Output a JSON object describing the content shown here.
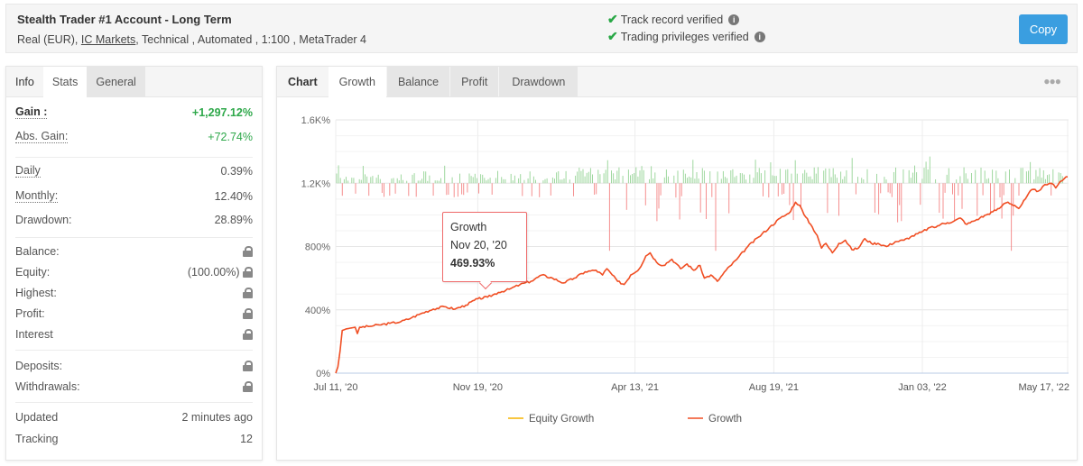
{
  "header": {
    "title": "Stealth Trader #1 Account - Long Term",
    "subtitle_prefix": "Real (EUR),",
    "broker_link": "IC Markets",
    "subtitle_suffix": ", Technical , Automated , 1:100 , MetaTrader 4",
    "verifications": [
      {
        "label": "Track record verified",
        "icon": "check-icon"
      },
      {
        "label": "Trading privileges verified",
        "icon": "check-icon"
      }
    ],
    "copy_label": "Copy"
  },
  "left_panel": {
    "tabs": [
      "Info",
      "Stats",
      "General"
    ],
    "active_tab": "Stats",
    "gain": {
      "label": "Gain :",
      "value": "+1,297.12%"
    },
    "abs_gain": {
      "label": "Abs. Gain:",
      "value": "+72.74%"
    },
    "daily": {
      "label": "Daily",
      "value": "0.39%"
    },
    "monthly": {
      "label": "Monthly:",
      "value": "12.40%"
    },
    "drawdown": {
      "label": "Drawdown:",
      "value": "28.89%"
    },
    "balance": {
      "label": "Balance:"
    },
    "equity": {
      "label": "Equity:",
      "value": "(100.00%)"
    },
    "highest": {
      "label": "Highest:"
    },
    "profit": {
      "label": "Profit:"
    },
    "interest": {
      "label": "Interest"
    },
    "deposits": {
      "label": "Deposits:"
    },
    "withdrawals": {
      "label": "Withdrawals:"
    },
    "updated": {
      "label": "Updated",
      "value": "2 minutes ago"
    },
    "tracking": {
      "label": "Tracking",
      "value": "12"
    }
  },
  "chart_panel": {
    "tabs": [
      "Chart",
      "Growth",
      "Balance",
      "Profit",
      "Drawdown"
    ],
    "active_tab": "Growth",
    "menu_icon": "more-dots-icon"
  },
  "tooltip": {
    "series": "Growth",
    "date": "Nov 20, '20",
    "value": "469.93%"
  },
  "colors": {
    "growth": "#f04e23",
    "equity": "#f5b400",
    "profit_bar": "#8fd18f",
    "loss_bar": "#f47c7c",
    "accent": "#3a9ee0",
    "positive": "#2ea84a"
  },
  "chart_data": {
    "type": "line",
    "title": "",
    "xlabel": "",
    "ylabel": "",
    "ylim": [
      0,
      1600
    ],
    "y_ticks": [
      "0%",
      "400%",
      "800%",
      "1.2K%",
      "1.6K%"
    ],
    "y_tick_values": [
      0,
      400,
      800,
      1200,
      1600
    ],
    "x_ticks": [
      "Jul 11, '20",
      "Nov 19, '20",
      "Apr 13, '21",
      "Aug 19, '21",
      "Jan 03, '22",
      "May 17, '22"
    ],
    "x_range_days": [
      0,
      675
    ],
    "x_tick_days": [
      0,
      131,
      276,
      404,
      541,
      675
    ],
    "grid": true,
    "legend": {
      "position": "bottom",
      "entries": [
        "Equity Growth",
        "Growth"
      ]
    },
    "series": [
      {
        "name": "Growth",
        "points": [
          [
            0,
            0
          ],
          [
            2,
            40
          ],
          [
            4,
            140
          ],
          [
            6,
            270
          ],
          [
            10,
            280
          ],
          [
            14,
            285
          ],
          [
            18,
            290
          ],
          [
            20,
            250
          ],
          [
            22,
            290
          ],
          [
            30,
            295
          ],
          [
            40,
            305
          ],
          [
            50,
            315
          ],
          [
            60,
            325
          ],
          [
            70,
            350
          ],
          [
            80,
            380
          ],
          [
            90,
            405
          ],
          [
            100,
            420
          ],
          [
            110,
            405
          ],
          [
            120,
            430
          ],
          [
            131,
            470
          ],
          [
            140,
            480
          ],
          [
            150,
            510
          ],
          [
            160,
            530
          ],
          [
            170,
            560
          ],
          [
            180,
            580
          ],
          [
            190,
            620
          ],
          [
            200,
            600
          ],
          [
            210,
            570
          ],
          [
            220,
            600
          ],
          [
            230,
            640
          ],
          [
            240,
            650
          ],
          [
            246,
            620
          ],
          [
            250,
            660
          ],
          [
            260,
            580
          ],
          [
            266,
            560
          ],
          [
            272,
            620
          ],
          [
            280,
            660
          ],
          [
            286,
            740
          ],
          [
            290,
            760
          ],
          [
            296,
            700
          ],
          [
            302,
            680
          ],
          [
            310,
            720
          ],
          [
            318,
            660
          ],
          [
            324,
            690
          ],
          [
            330,
            650
          ],
          [
            336,
            680
          ],
          [
            340,
            600
          ],
          [
            346,
            620
          ],
          [
            352,
            580
          ],
          [
            360,
            650
          ],
          [
            370,
            720
          ],
          [
            380,
            800
          ],
          [
            390,
            860
          ],
          [
            400,
            920
          ],
          [
            410,
            980
          ],
          [
            418,
            1010
          ],
          [
            424,
            1080
          ],
          [
            428,
            1060
          ],
          [
            432,
            1000
          ],
          [
            438,
            940
          ],
          [
            444,
            870
          ],
          [
            448,
            790
          ],
          [
            452,
            820
          ],
          [
            458,
            760
          ],
          [
            464,
            820
          ],
          [
            470,
            840
          ],
          [
            476,
            780
          ],
          [
            482,
            790
          ],
          [
            488,
            850
          ],
          [
            494,
            820
          ],
          [
            500,
            820
          ],
          [
            508,
            800
          ],
          [
            516,
            830
          ],
          [
            524,
            840
          ],
          [
            530,
            860
          ],
          [
            540,
            890
          ],
          [
            548,
            920
          ],
          [
            552,
            920
          ],
          [
            558,
            940
          ],
          [
            564,
            950
          ],
          [
            570,
            960
          ],
          [
            576,
            980
          ],
          [
            582,
            940
          ],
          [
            588,
            960
          ],
          [
            594,
            980
          ],
          [
            600,
            1000
          ],
          [
            606,
            1020
          ],
          [
            612,
            1040
          ],
          [
            616,
            1070
          ],
          [
            620,
            1080
          ],
          [
            626,
            1060
          ],
          [
            630,
            1040
          ],
          [
            636,
            1100
          ],
          [
            642,
            1160
          ],
          [
            648,
            1150
          ],
          [
            652,
            1180
          ],
          [
            656,
            1190
          ],
          [
            660,
            1200
          ],
          [
            664,
            1170
          ],
          [
            668,
            1210
          ],
          [
            672,
            1230
          ],
          [
            675,
            1240
          ]
        ]
      },
      {
        "name": "Equity Growth",
        "points": []
      }
    ],
    "daily_profit_bars": {
      "baseline": 1200,
      "note": "Green (profit) bars rise above the 1.2K% baseline, red (loss) bars drop below it, one per trading day"
    }
  }
}
